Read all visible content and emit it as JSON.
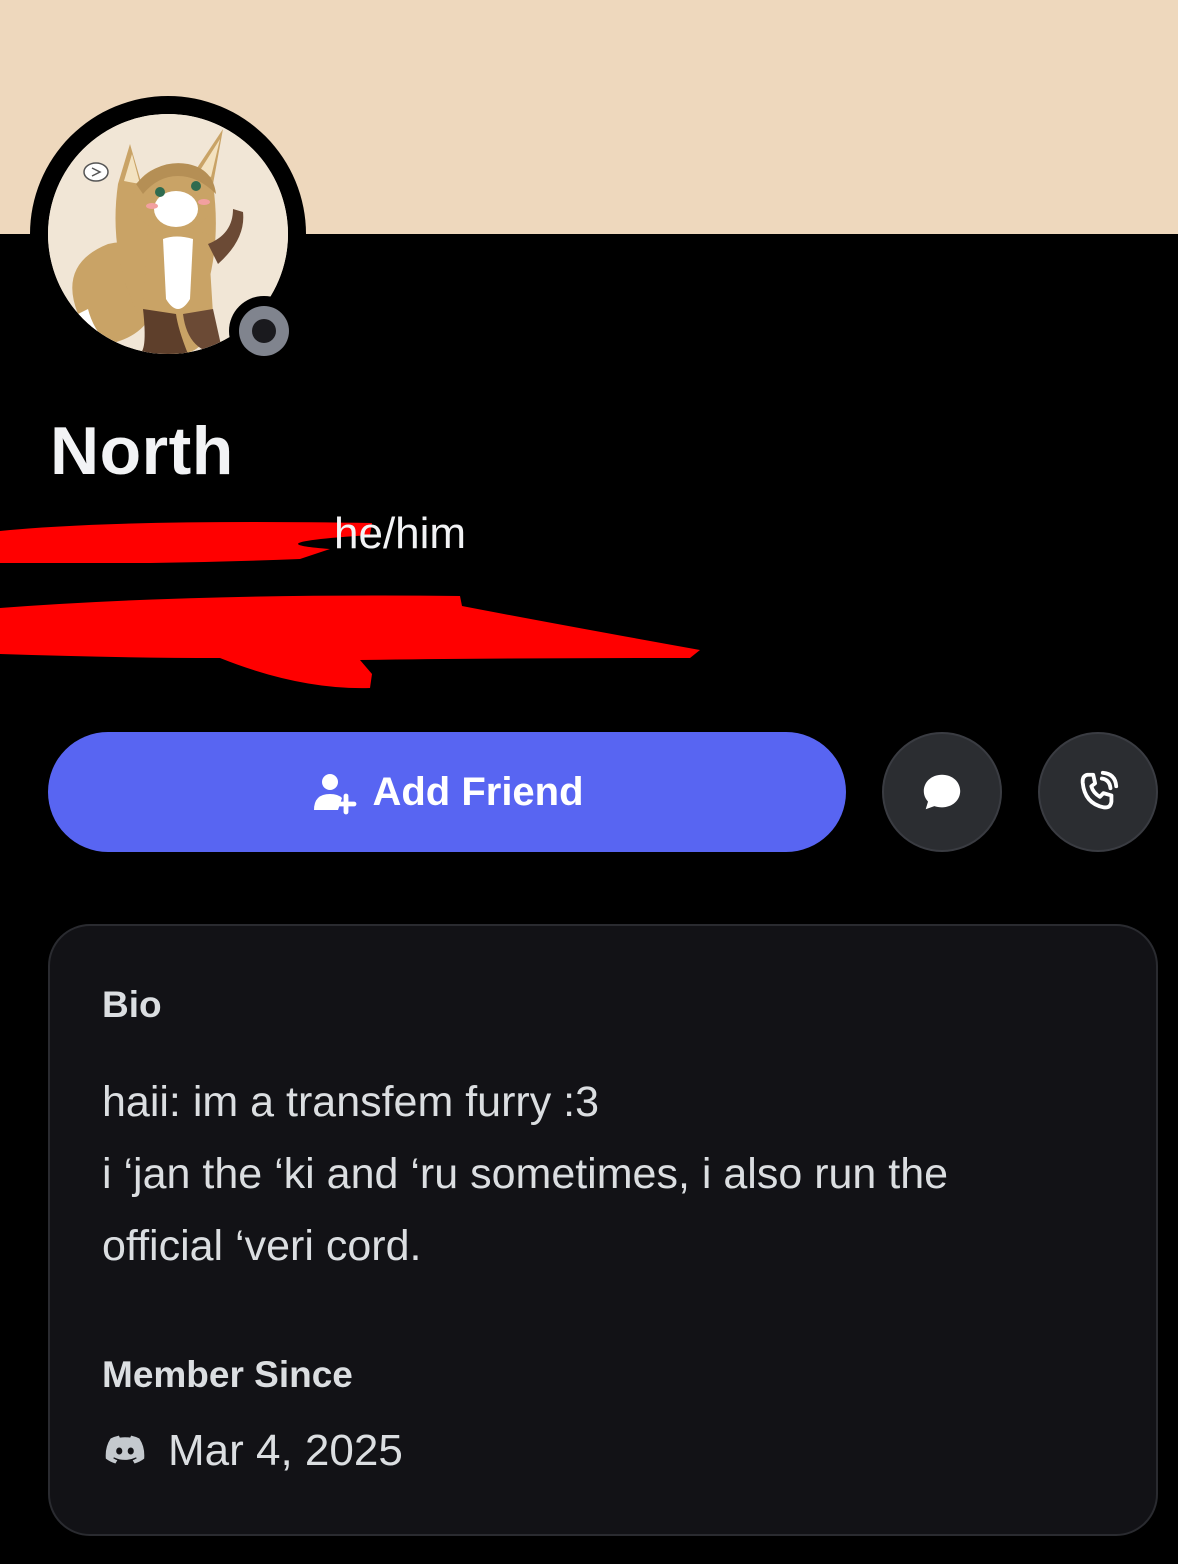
{
  "profile": {
    "display_name": "North",
    "pronouns": "he/him",
    "status": "offline",
    "banner_color": "#eed8bd"
  },
  "actions": {
    "add_friend_label": "Add Friend",
    "message_icon": "chat-bubble-icon",
    "call_icon": "phone-call-icon",
    "accent": "#5865f2"
  },
  "bio": {
    "title": "Bio",
    "lines": [
      "haii: im a transfem furry :3",
      "i ‘jan the ‘ki and ‘ru sometimes, i also run the",
      "official ‘veri cord."
    ]
  },
  "member_since": {
    "title": "Member Since",
    "date": "Mar 4, 2025",
    "icon": "discord-logo-icon"
  }
}
